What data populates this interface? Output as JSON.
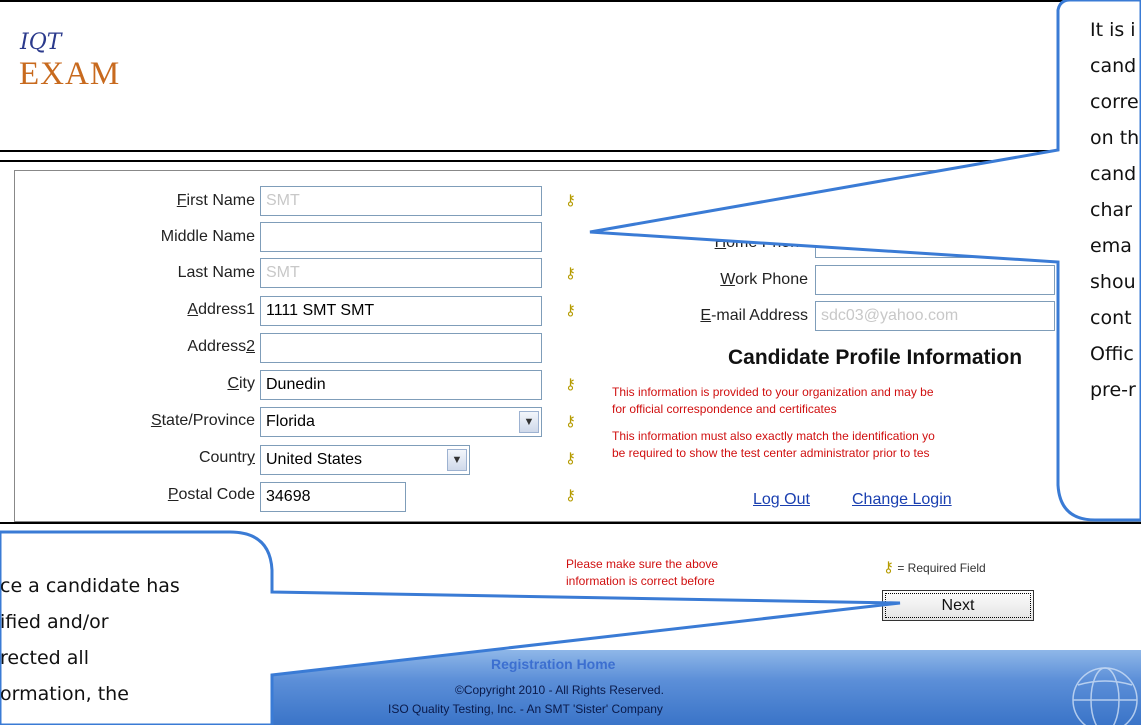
{
  "logo": {
    "line1": "IQT",
    "line2": "EXAM"
  },
  "form": {
    "first_name": {
      "label_u": "F",
      "label_rest": "irst Name",
      "value": "SMT"
    },
    "middle_name": {
      "label": "Middle Name",
      "value": ""
    },
    "last_name": {
      "label": "Last Name",
      "value": "SMT"
    },
    "address1": {
      "label_u": "A",
      "label_rest": "ddress1",
      "value": "1111 SMT SMT"
    },
    "address2": {
      "label_pre": "Address",
      "label_u": "2",
      "value": ""
    },
    "city": {
      "label_u": "C",
      "label_rest": "ity",
      "value": "Dunedin"
    },
    "state": {
      "label_u": "S",
      "label_rest": "tate/Province",
      "value": "Florida"
    },
    "country": {
      "label_pre": "Countr",
      "label_u": "y",
      "value": "United States"
    },
    "postal_code": {
      "label_u": "P",
      "label_rest": "ostal Code",
      "value": "34698"
    },
    "home_phone": {
      "label_u": "H",
      "label_rest": "ome Phone",
      "value": ""
    },
    "work_phone": {
      "label_u": "W",
      "label_rest": "ork Phone",
      "value": ""
    },
    "email": {
      "label_u": "E",
      "label_rest": "-mail Address",
      "value": "sdc03@yahoo.com"
    }
  },
  "profile": {
    "title": "Candidate Profile Information",
    "note1_line1": "This information is provided to your organization and may be",
    "note1_line2": "for official correspondence and certificates",
    "note2_line1": "This information must also exactly match the identification yo",
    "note2_line2": "be required to show the test center administrator prior to tes",
    "logout": "Log Out",
    "change_login": "Change Login"
  },
  "bottom": {
    "make_sure_line1": "Please make sure the above",
    "make_sure_line2": "information is correct before",
    "required_legend": "= Required Field",
    "next": "Next"
  },
  "footer": {
    "registration_home": "Registration Home",
    "copyright": "©Copyright 2010 - All Rights Reserved.",
    "company": "ISO Quality Testing, Inc. - An SMT 'Sister' Company"
  },
  "callout_right": {
    "lines": [
      "It is i",
      "cand",
      "corre",
      "on th",
      "cand",
      "char",
      "ema",
      "shou",
      "cont",
      "Offic",
      "pre-r"
    ]
  },
  "callout_left": {
    "lines": [
      "ce a candidate has",
      "ified and/or",
      "rected all",
      "ormation, the"
    ]
  },
  "colors": {
    "link": "#1a3fb0",
    "warning": "#d01010",
    "logo_orange": "#c86a1e",
    "logo_blue": "#2b3a8c",
    "callout_border": "#3a7bd5"
  }
}
